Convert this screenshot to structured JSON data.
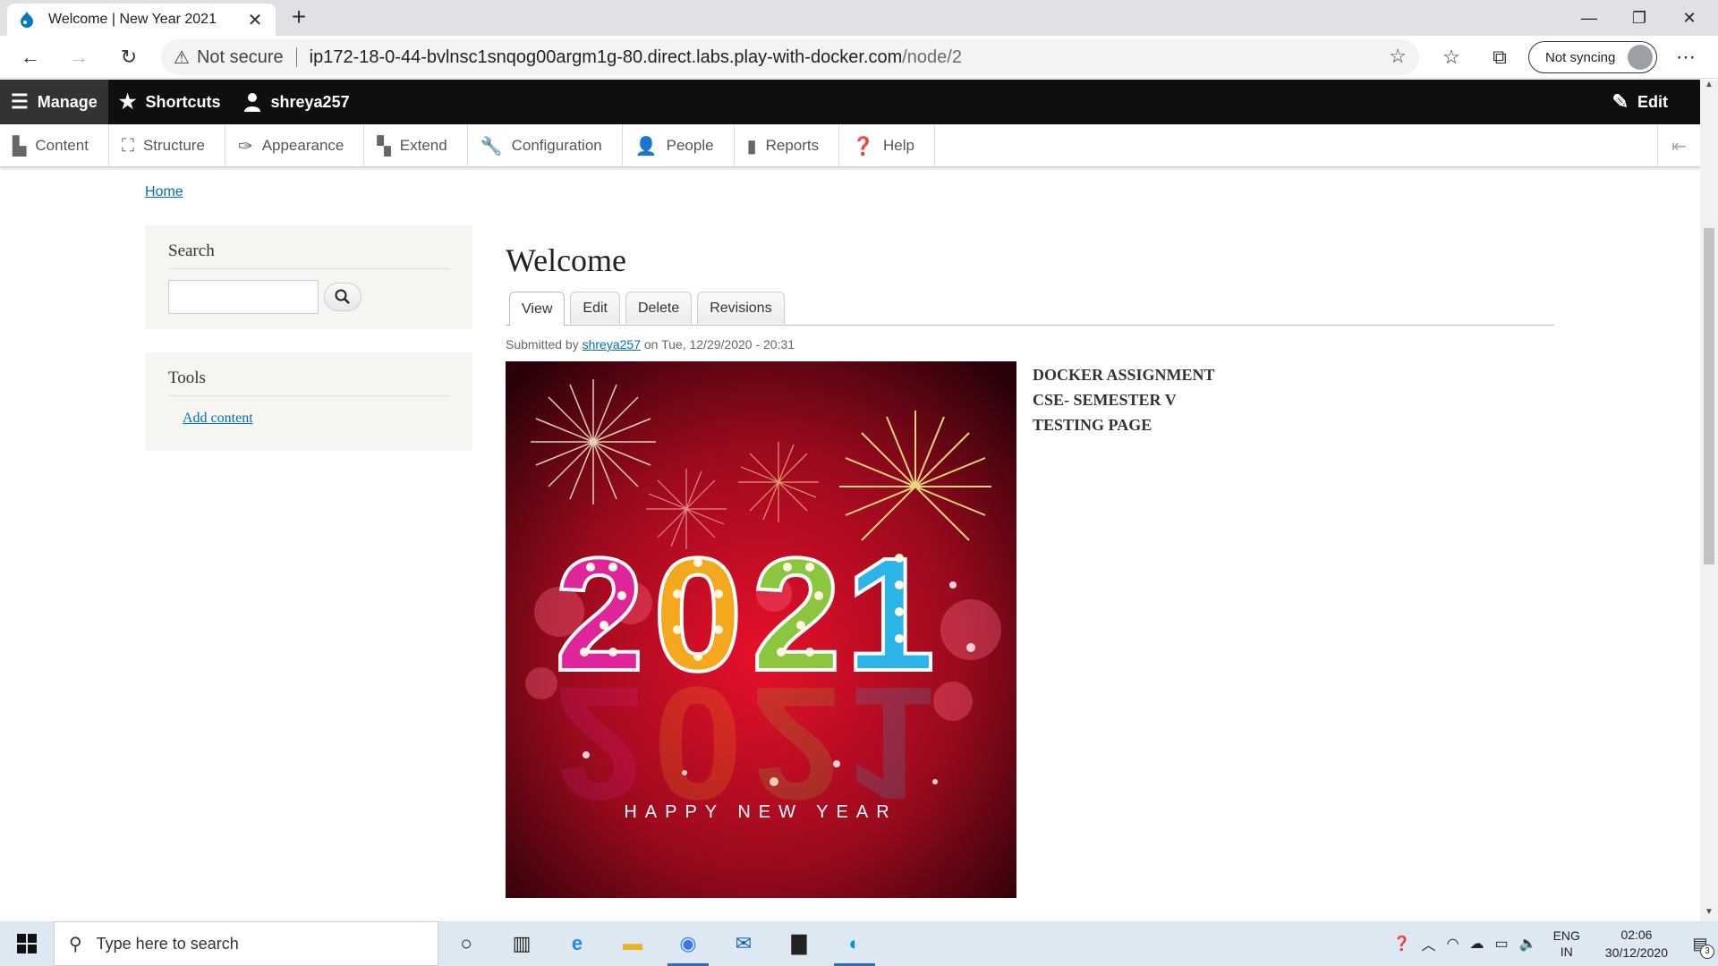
{
  "browser": {
    "tab_title": "Welcome | New Year 2021",
    "address_warning": "Not secure",
    "url_host": "ip172-18-0-44-bvlnsc1snqog00argm1g-80.direct.labs.play-with-docker.com",
    "url_path": "/node/2",
    "sync_label": "Not syncing"
  },
  "admin_toolbar": {
    "manage": "Manage",
    "shortcuts": "Shortcuts",
    "user": "shreya257",
    "edit": "Edit"
  },
  "admin_tray": {
    "items": [
      "Content",
      "Structure",
      "Appearance",
      "Extend",
      "Configuration",
      "People",
      "Reports",
      "Help"
    ]
  },
  "breadcrumb": "Home",
  "sidebar": {
    "search_title": "Search",
    "tools_title": "Tools",
    "tools_link": "Add content"
  },
  "node": {
    "title": "Welcome",
    "tabs": [
      "View",
      "Edit",
      "Delete",
      "Revisions"
    ],
    "submitted_prefix": "Submitted by",
    "author": "shreya257",
    "submitted_suffix": "on Tue, 12/29/2020 - 20:31",
    "body_lines": [
      "DOCKER ASSIGNMENT",
      "CSE- SEMESTER V",
      "TESTING PAGE"
    ],
    "image_year": "2021",
    "image_caption": "HAPPY NEW YEAR"
  },
  "taskbar": {
    "search_placeholder": "Type here to search",
    "lang_1": "ENG",
    "lang_2": "IN",
    "time": "02:06",
    "date": "30/12/2020",
    "notification_count": "3"
  },
  "colors": {
    "admin_bar": "#0f0f0f",
    "link": "#0071b3",
    "taskbar": "#dde8f2"
  }
}
